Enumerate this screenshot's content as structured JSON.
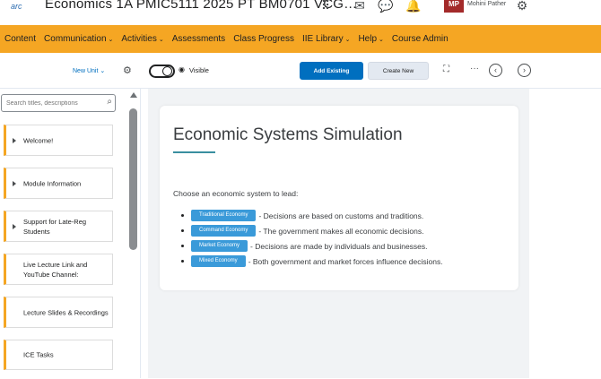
{
  "header": {
    "logo_text": "arc",
    "course_title": "Economics 1A PMIC5111 2025 PT BM0701 VCG…",
    "user_initials": "MP",
    "user_name": "Mohini Pather",
    "icons": [
      "apps-grid-icon",
      "mail-icon",
      "chat-icon",
      "bell-icon",
      "gear-icon"
    ]
  },
  "nav": {
    "items": [
      {
        "label": "Content",
        "dropdown": false
      },
      {
        "label": "Communication",
        "dropdown": true
      },
      {
        "label": "Activities",
        "dropdown": true
      },
      {
        "label": "Assessments",
        "dropdown": false
      },
      {
        "label": "Class Progress",
        "dropdown": false
      },
      {
        "label": "IIE Library",
        "dropdown": true
      },
      {
        "label": "Help",
        "dropdown": true
      },
      {
        "label": "Course Admin",
        "dropdown": false
      }
    ],
    "accent": "#f5a623"
  },
  "sidebar": {
    "new_unit_label": "New Unit",
    "search_placeholder": "Search titles, descriptions",
    "modules": [
      {
        "label": "Welcome!",
        "expandable": true
      },
      {
        "label": "Module Information",
        "expandable": true
      },
      {
        "label": "Support for Late-Reg Students",
        "expandable": true
      },
      {
        "label": "Live Lecture Link and YouTube Channel:",
        "expandable": false
      },
      {
        "label": "Lecture Slides & Recordings",
        "expandable": false
      },
      {
        "label": "ICE Tasks",
        "expandable": false
      }
    ]
  },
  "toolbar": {
    "visibility_label": "Visible",
    "visible": true,
    "add_existing_label": "Add Existing",
    "create_new_label": "Create New",
    "more_label": "···",
    "prev_label": "‹",
    "next_label": "›"
  },
  "content": {
    "title": "Economic Systems Simulation",
    "prompt": "Choose an economic system to lead:",
    "systems": [
      {
        "label": "Traditional Economy",
        "description": "- Decisions are based on customs and traditions."
      },
      {
        "label": "Command Economy",
        "description": "- The government makes all economic decisions."
      },
      {
        "label": "Market Economy",
        "description": "- Decisions are made by individuals and businesses."
      },
      {
        "label": "Mixed Economy",
        "description": "- Both government and market forces influence decisions."
      }
    ],
    "chip_color": "#3a9ad9"
  }
}
